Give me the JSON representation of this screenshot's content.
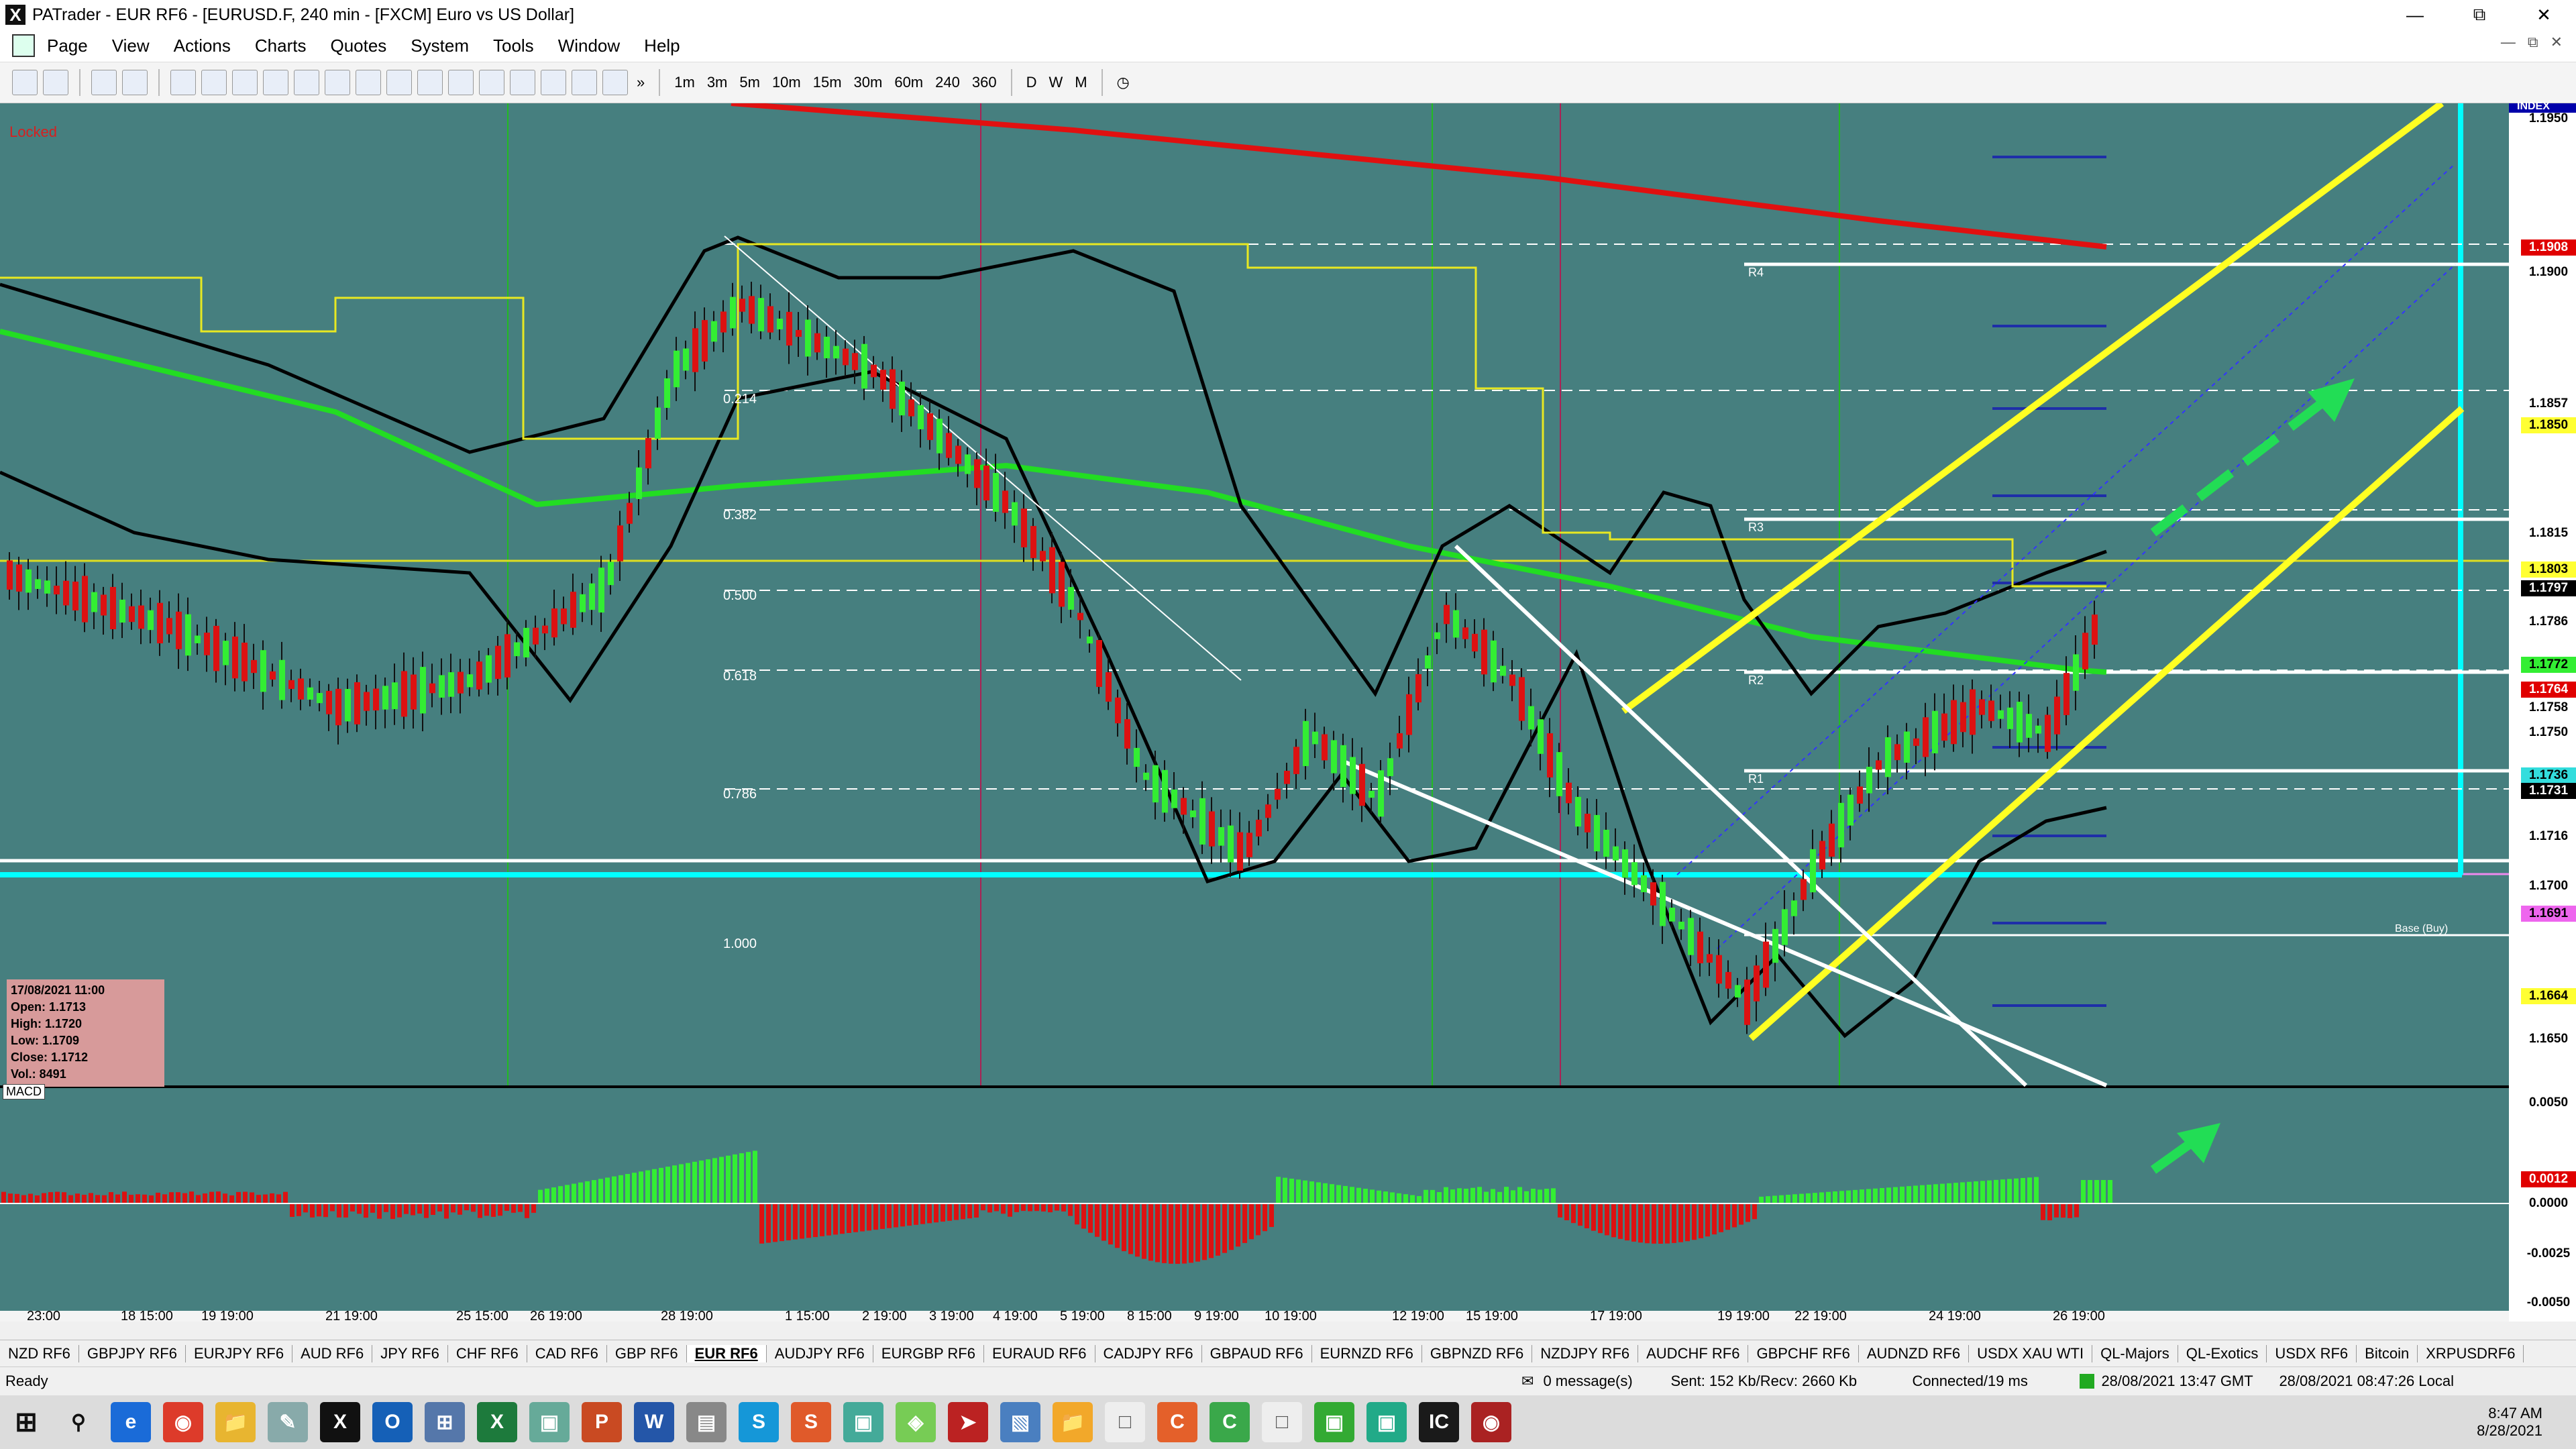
{
  "window": {
    "title": "PATrader - EUR RF6 - [EURUSD.F, 240 min - [FXCM] Euro vs US Dollar]"
  },
  "menu": [
    "Page",
    "View",
    "Actions",
    "Charts",
    "Quotes",
    "System",
    "Tools",
    "Window",
    "Help"
  ],
  "toolbar": {
    "timeframes": [
      "1m",
      "3m",
      "5m",
      "10m",
      "15m",
      "30m",
      "60m",
      "240",
      "360",
      "D",
      "W",
      "M"
    ]
  },
  "chart": {
    "locked_label": "Locked",
    "index_label": "INDEX",
    "ohlc": {
      "date": "17/08/2021 11:00",
      "open": "Open: 1.1713",
      "high": "High: 1.1720",
      "low": "Low: 1.1709",
      "close": "Close: 1.1712",
      "vol": "Vol.: 8491"
    },
    "fib_labels": [
      "0.214",
      "0.382",
      "0.500",
      "0.618",
      "0.786",
      "1.000"
    ],
    "pivot_labels": [
      "R4",
      "R3",
      "R2",
      "R1",
      "Base (Buy)"
    ],
    "price_axis": [
      {
        "v": "1.1950",
        "bg": "",
        "fg": "#000"
      },
      {
        "v": "1.1908",
        "bg": "#e00000",
        "fg": "#fff"
      },
      {
        "v": "1.1900",
        "bg": "",
        "fg": "#000"
      },
      {
        "v": "1.1857",
        "bg": "#ffffff",
        "fg": "#000"
      },
      {
        "v": "1.1850",
        "bg": "#ffff33",
        "fg": "#000"
      },
      {
        "v": "1.1815",
        "bg": "#ffffff",
        "fg": "#000"
      },
      {
        "v": "1.1803",
        "bg": "#ffff33",
        "fg": "#000"
      },
      {
        "v": "1.1797",
        "bg": "#000000",
        "fg": "#fff"
      },
      {
        "v": "1.1786",
        "bg": "#ffffff",
        "fg": "#000"
      },
      {
        "v": "1.1772",
        "bg": "#33ee33",
        "fg": "#000"
      },
      {
        "v": "1.1764",
        "bg": "#e00000",
        "fg": "#fff"
      },
      {
        "v": "1.1758",
        "bg": "#ffffff",
        "fg": "#000"
      },
      {
        "v": "1.1750",
        "bg": "",
        "fg": "#000"
      },
      {
        "v": "1.1736",
        "bg": "#33dddd",
        "fg": "#000"
      },
      {
        "v": "1.1731",
        "bg": "#000000",
        "fg": "#fff"
      },
      {
        "v": "1.1716",
        "bg": "#ffffff",
        "fg": "#000"
      },
      {
        "v": "1.1700",
        "bg": "",
        "fg": "#000"
      },
      {
        "v": "1.1691",
        "bg": "#ee66ee",
        "fg": "#000"
      },
      {
        "v": "1.1664",
        "bg": "#ffff33",
        "fg": "#000"
      },
      {
        "v": "1.1650",
        "bg": "",
        "fg": "#000"
      }
    ],
    "macd_axis": [
      {
        "v": "0.0050",
        "bg": "",
        "fg": "#000"
      },
      {
        "v": "0.0012",
        "bg": "#e00000",
        "fg": "#fff"
      },
      {
        "v": "0.0000",
        "bg": "",
        "fg": "#000"
      },
      {
        "v": "-0.0025",
        "bg": "",
        "fg": "#000"
      },
      {
        "v": "-0.0050",
        "bg": "",
        "fg": "#000"
      }
    ],
    "macd_label": "MACD",
    "time_labels": [
      "23:00",
      "18 15:00",
      "19 19:00",
      "21 19:00",
      "25 15:00",
      "26 19:00",
      "28 19:00",
      "1 15:00",
      "2 19:00",
      "3 19:00",
      "4 19:00",
      "5 19:00",
      "8 15:00",
      "9 19:00",
      "10 19:00",
      "12 19:00",
      "15 19:00",
      "17 19:00",
      "19 19:00",
      "22 19:00",
      "24 19:00",
      "26 19:00"
    ]
  },
  "tabs": [
    "NZD RF6",
    "GBPJPY RF6",
    "EURJPY RF6",
    "AUD RF6",
    "JPY RF6",
    "CHF RF6",
    "CAD RF6",
    "GBP RF6",
    "EUR RF6",
    "AUDJPY RF6",
    "EURGBP RF6",
    "EURAUD RF6",
    "CADJPY RF6",
    "GBPAUD RF6",
    "EURNZD RF6",
    "GBPNZD RF6",
    "NZDJPY RF6",
    "AUDCHF RF6",
    "GBPCHF RF6",
    "AUDNZD RF6",
    "USDX XAU WTI",
    "QL-Majors",
    "QL-Exotics",
    "USDX RF6",
    "Bitcoin",
    "XRPUSDRF6"
  ],
  "active_tab": "EUR RF6",
  "status": {
    "ready": "Ready",
    "messages": "0 message(s)",
    "sent": "Sent: 152 Kb/Recv: 2660 Kb",
    "connected": "Connected/19 ms",
    "gmt": "28/08/2021 13:47 GMT",
    "local": "28/08/2021 08:47:26 Local"
  },
  "clock": {
    "time": "8:47 AM",
    "date": "8/28/2021"
  }
}
